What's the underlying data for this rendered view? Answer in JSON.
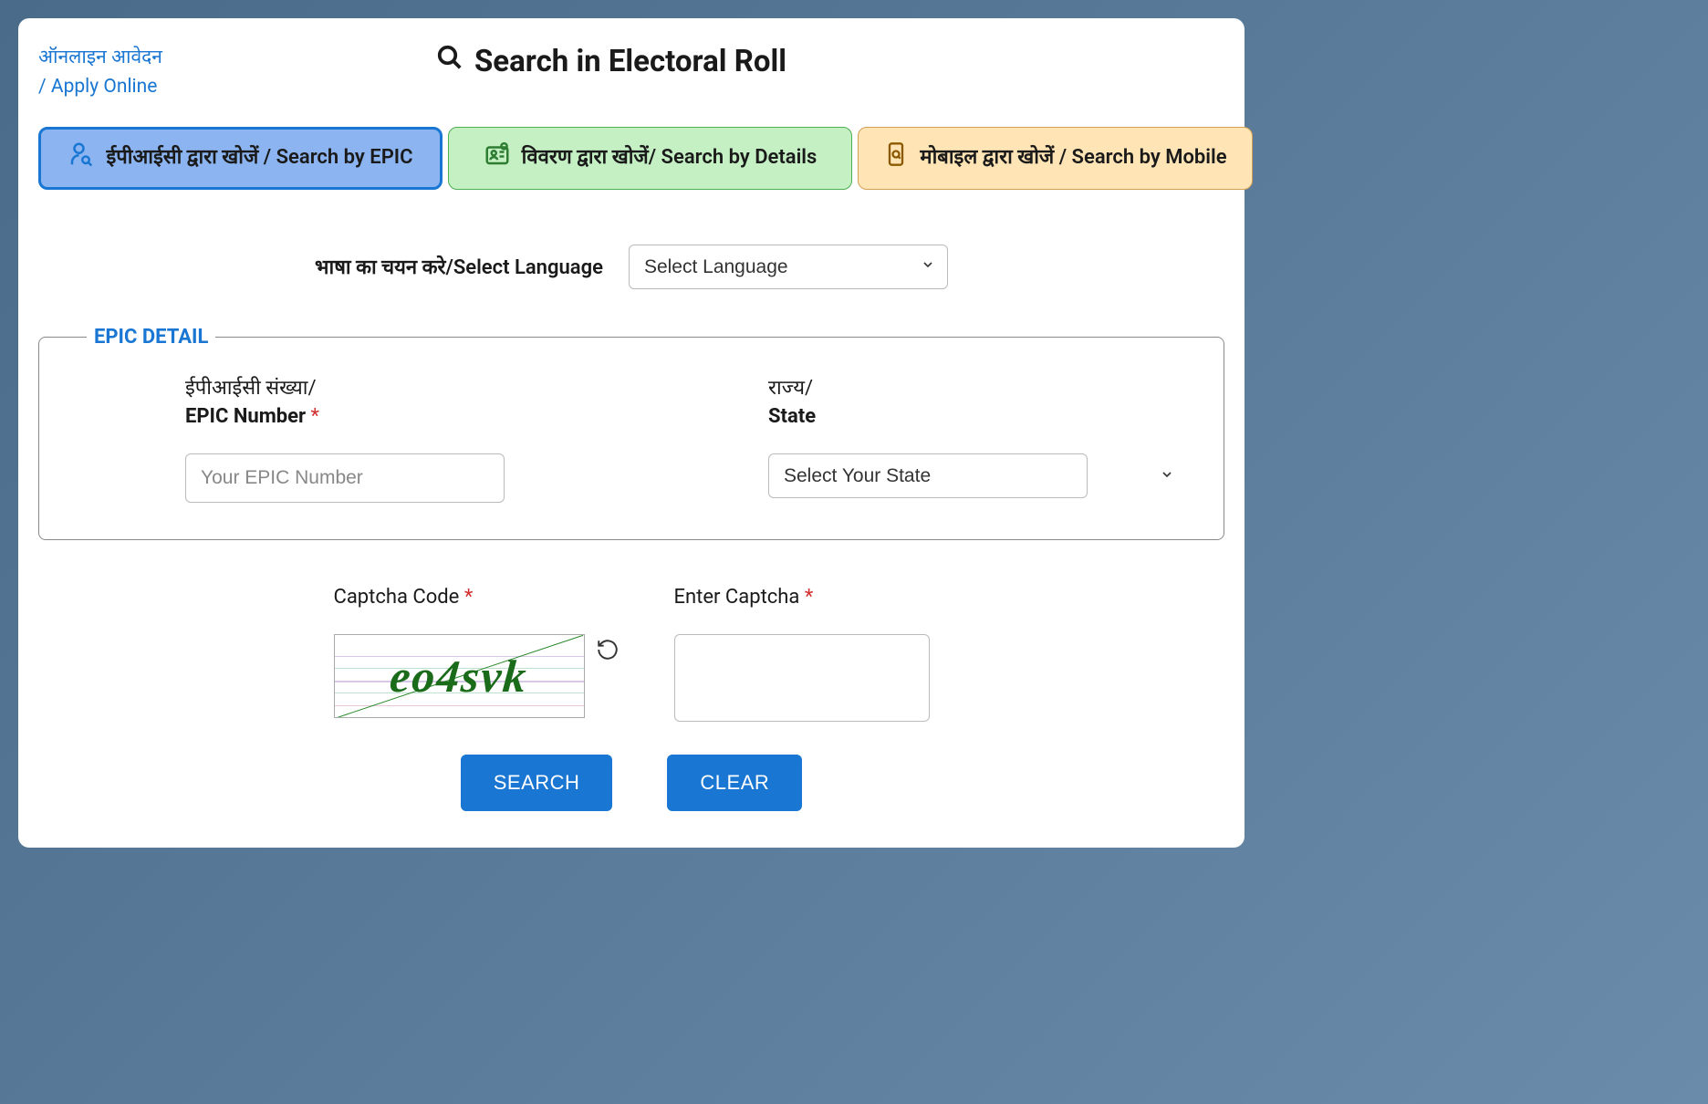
{
  "header": {
    "apply_link_hi": "ऑनलाइन आवेदन",
    "apply_link_en": "/ Apply Online",
    "title": "Search in Electoral Roll"
  },
  "tabs": {
    "epic": "ईपीआईसी द्वारा खोजें / Search by EPIC",
    "details": "विवरण द्वारा खोजें/ Search by Details",
    "mobile": "मोबाइल द्वारा खोजें / Search by Mobile"
  },
  "language": {
    "label": "भाषा का चयन करे/Select Language",
    "placeholder": "Select Language"
  },
  "fieldset": {
    "legend": "EPIC DETAIL",
    "epic_label_hi": "ईपीआईसी संख्या/",
    "epic_label_en": "EPIC Number",
    "epic_placeholder": "Your EPIC Number",
    "state_label_hi": "राज्य/",
    "state_label_en": "State",
    "state_placeholder": "Select Your State"
  },
  "captcha": {
    "code_label": "Captcha Code",
    "enter_label": "Enter Captcha",
    "value": "eo4svk"
  },
  "buttons": {
    "search": "SEARCH",
    "clear": "CLEAR"
  }
}
